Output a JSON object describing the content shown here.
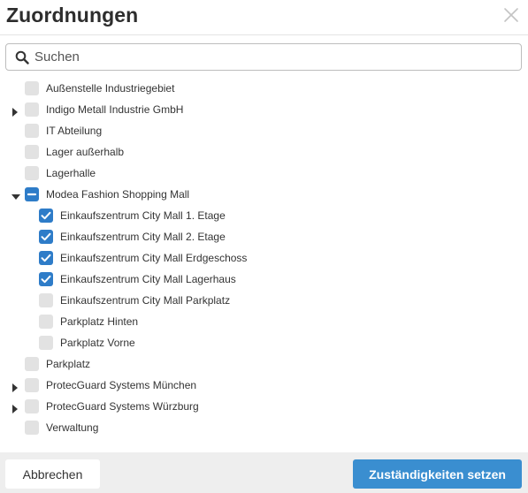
{
  "dialog": {
    "title": "Zuordnungen",
    "close_icon": "close-icon"
  },
  "search": {
    "placeholder": "Suchen",
    "value": "",
    "icon": "search-icon"
  },
  "tree": {
    "items": [
      {
        "label": "Außenstelle Industriegebiet",
        "level": 0,
        "expander": "none",
        "state": "unchecked"
      },
      {
        "label": "Indigo Metall Industrie GmbH",
        "level": 0,
        "expander": "collapsed",
        "state": "unchecked"
      },
      {
        "label": "IT Abteilung",
        "level": 0,
        "expander": "none",
        "state": "unchecked"
      },
      {
        "label": "Lager außerhalb",
        "level": 0,
        "expander": "none",
        "state": "unchecked"
      },
      {
        "label": "Lagerhalle",
        "level": 0,
        "expander": "none",
        "state": "unchecked"
      },
      {
        "label": "Modea Fashion Shopping Mall",
        "level": 0,
        "expander": "expanded",
        "state": "partial"
      },
      {
        "label": "Einkaufszentrum City Mall 1. Etage",
        "level": 1,
        "expander": "none",
        "state": "checked"
      },
      {
        "label": "Einkaufszentrum City Mall 2. Etage",
        "level": 1,
        "expander": "none",
        "state": "checked"
      },
      {
        "label": "Einkaufszentrum City Mall Erdgeschoss",
        "level": 1,
        "expander": "none",
        "state": "checked"
      },
      {
        "label": "Einkaufszentrum City Mall Lagerhaus",
        "level": 1,
        "expander": "none",
        "state": "checked"
      },
      {
        "label": "Einkaufszentrum City Mall Parkplatz",
        "level": 1,
        "expander": "none",
        "state": "unchecked"
      },
      {
        "label": "Parkplatz Hinten",
        "level": 1,
        "expander": "none",
        "state": "unchecked"
      },
      {
        "label": "Parkplatz Vorne",
        "level": 1,
        "expander": "none",
        "state": "unchecked"
      },
      {
        "label": "Parkplatz",
        "level": 0,
        "expander": "none",
        "state": "unchecked"
      },
      {
        "label": "ProtecGuard Systems München",
        "level": 0,
        "expander": "collapsed",
        "state": "unchecked"
      },
      {
        "label": "ProtecGuard Systems Würzburg",
        "level": 0,
        "expander": "collapsed",
        "state": "unchecked"
      },
      {
        "label": "Verwaltung",
        "level": 0,
        "expander": "none",
        "state": "unchecked"
      }
    ]
  },
  "footer": {
    "cancel_label": "Abbrechen",
    "submit_label": "Zuständigkeiten setzen"
  },
  "colors": {
    "accent": "#2e7cc8",
    "primary_button": "#3a8ed0",
    "checkbox_empty": "#e2e2e2",
    "footer_bg": "#eeeeee"
  }
}
